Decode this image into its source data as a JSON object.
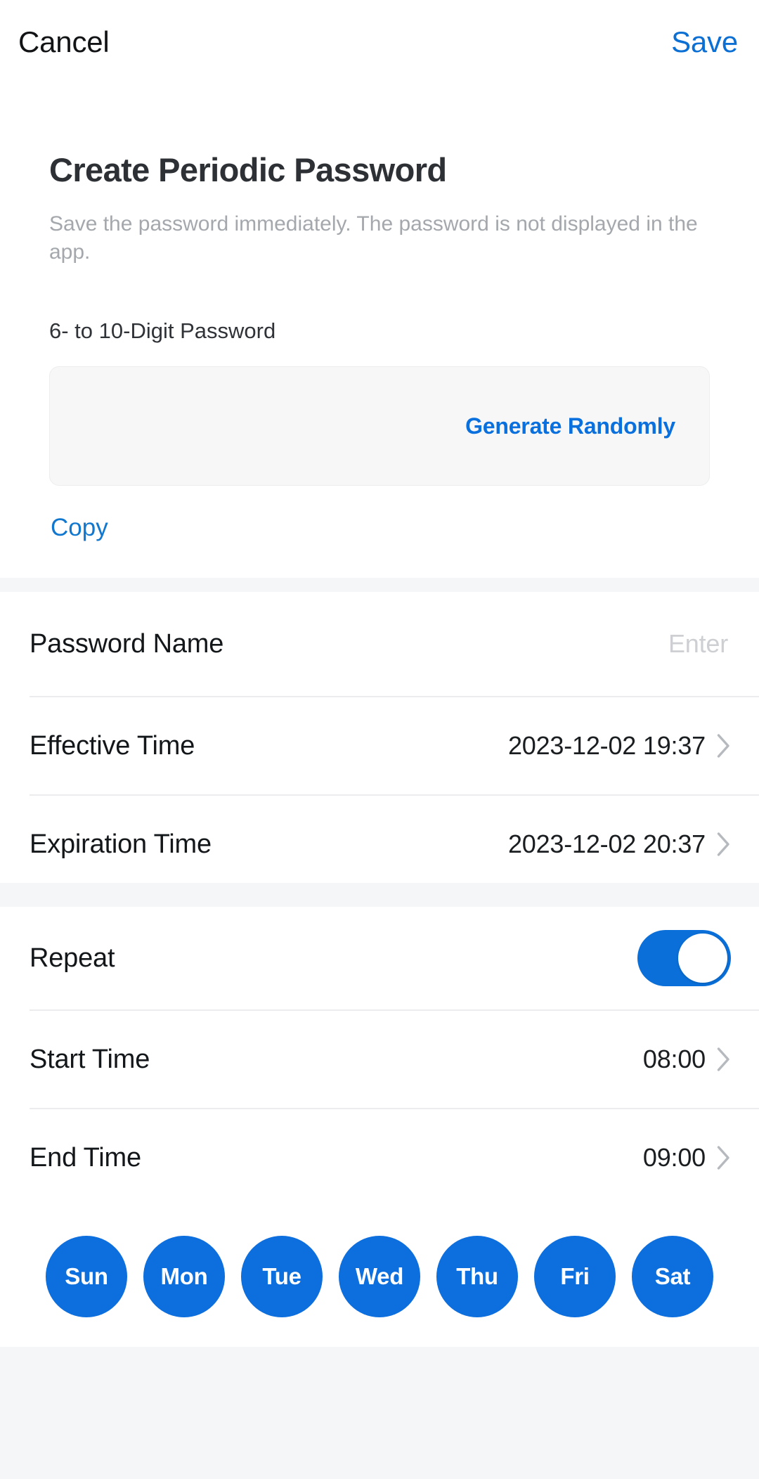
{
  "topbar": {
    "cancel_label": "Cancel",
    "save_label": "Save"
  },
  "header": {
    "title": "Create Periodic Password",
    "description": "Save the password immediately. The password is not displayed in the app."
  },
  "password_field": {
    "label": "6- to 10-Digit Password",
    "value": "",
    "placeholder": "",
    "generate_label": "Generate Randomly",
    "copy_label": "Copy"
  },
  "details_section": {
    "rows": [
      {
        "label": "Password Name",
        "value": "",
        "placeholder": "Enter",
        "kind": "input"
      },
      {
        "label": "Effective Time",
        "value": "2023-12-02 19:37",
        "kind": "navigate"
      },
      {
        "label": "Expiration Time",
        "value": "2023-12-02 20:37",
        "kind": "navigate"
      }
    ]
  },
  "repeat_section": {
    "repeat": {
      "label": "Repeat",
      "enabled": true
    },
    "start_time": {
      "label": "Start Time",
      "value": "08:00"
    },
    "end_time": {
      "label": "End Time",
      "value": "09:00"
    },
    "days": [
      {
        "label": "Sun",
        "selected": true
      },
      {
        "label": "Mon",
        "selected": true
      },
      {
        "label": "Tue",
        "selected": true
      },
      {
        "label": "Wed",
        "selected": true
      },
      {
        "label": "Thu",
        "selected": true
      },
      {
        "label": "Fri",
        "selected": true
      },
      {
        "label": "Sat",
        "selected": true
      }
    ]
  },
  "colors": {
    "accent_blue": "#0b6fd4",
    "link_blue": "#1177cf",
    "generate_blue": "#0a70dd",
    "day_selected": "#0d6ede",
    "toggle_on": "#0a6fd8",
    "page_background": "#f5f6f7",
    "card_background": "#ffffff",
    "divider": "#ececee",
    "muted_text": "#a4a8ad",
    "placeholder_text": "#cdcfd2"
  }
}
